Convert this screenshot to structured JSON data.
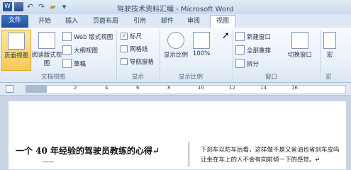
{
  "window": {
    "title": "驾驶技术资料汇编 - Microsoft Word"
  },
  "quick_access": {
    "word_logo": "W"
  },
  "tabs": [
    "文件",
    "开始",
    "插入",
    "页面布局",
    "引用",
    "邮件",
    "审阅",
    "视图"
  ],
  "ribbon": {
    "doc_views": {
      "label": "文档视图",
      "print_layout": "页面视图",
      "reading_layout": "阅读版式视图",
      "web_layout": "Web 版式视图",
      "outline": "大纲视图",
      "draft": "草稿"
    },
    "show": {
      "label": "显示",
      "ruler": "标尺",
      "gridlines": "网格线",
      "nav_pane": "导航窗格"
    },
    "zoom": {
      "label": "显示比例",
      "zoom": "显示比例",
      "hundred": "100%"
    },
    "window": {
      "label": "窗口",
      "new_window": "新建窗口",
      "arrange_all": "全部重排",
      "split": "拆分",
      "switch_windows": "切换窗口"
    },
    "macros": {
      "label": "宏",
      "macros": "宏"
    }
  },
  "ruler": {
    "numbers": [
      "2",
      "4",
      "6",
      "8",
      "10",
      "12",
      "14",
      "16"
    ]
  },
  "document": {
    "heading": "一个 40 年经验的驾驶员教练的心得↵",
    "subtext": "——",
    "right_line1": "下刹车以防车后看，这样做不是又省油也省刹车皮吗",
    "right_line2": "让坐在车上的人不会有向前倾一下的感觉。↵"
  },
  "colors": {
    "file_tab": "#2f5fae",
    "active_view": "#f8c85a"
  }
}
